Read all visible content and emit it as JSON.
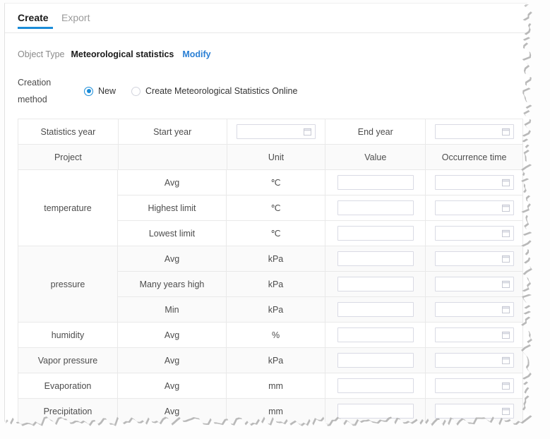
{
  "tabs": [
    {
      "label": "Create",
      "active": true
    },
    {
      "label": "Export",
      "active": false
    }
  ],
  "object_type": {
    "label": "Object Type",
    "value": "Meteorological statistics",
    "modify_link": "Modify"
  },
  "creation_method": {
    "label_line1": "Creation",
    "label_line2": "method",
    "options": [
      {
        "label": "New",
        "selected": true
      },
      {
        "label": "Create Meteorological Statistics Online",
        "selected": false
      }
    ]
  },
  "year_row": {
    "statistics_year_label": "Statistics year",
    "start_year_label": "Start year",
    "start_year_value": "",
    "end_year_label": "End year",
    "end_year_value": ""
  },
  "table": {
    "headers": [
      "Project",
      "",
      "Unit",
      "Value",
      "Occurrence time"
    ],
    "rows": [
      {
        "project": "temperature",
        "rowspan": 3,
        "metric": "Avg",
        "unit": "℃",
        "value": "",
        "time": ""
      },
      {
        "project": "",
        "metric": "Highest limit",
        "unit": "℃",
        "value": "",
        "time": ""
      },
      {
        "project": "",
        "metric": "Lowest limit",
        "unit": "℃",
        "value": "",
        "time": ""
      },
      {
        "project": "pressure",
        "rowspan": 3,
        "metric": "Avg",
        "unit": "kPa",
        "value": "",
        "time": ""
      },
      {
        "project": "",
        "metric": "Many years high",
        "unit": "kPa",
        "value": "",
        "time": ""
      },
      {
        "project": "",
        "metric": "Min",
        "unit": "kPa",
        "value": "",
        "time": ""
      },
      {
        "project": "humidity",
        "rowspan": 1,
        "metric": "Avg",
        "unit": "%",
        "value": "",
        "time": ""
      },
      {
        "project": "Vapor pressure",
        "rowspan": 1,
        "metric": "Avg",
        "unit": "kPa",
        "value": "",
        "time": ""
      },
      {
        "project": "Evaporation",
        "rowspan": 1,
        "metric": "Avg",
        "unit": "mm",
        "value": "",
        "time": ""
      },
      {
        "project": "Precipitation",
        "rowspan": 1,
        "metric": "Avg",
        "unit": "mm",
        "value": "",
        "time": ""
      }
    ]
  },
  "icons": {
    "calendar": "calendar-icon"
  },
  "colors": {
    "accent": "#1a8cd8",
    "link": "#2a7fd4",
    "border": "#e9e9e9",
    "input_border": "#d9dae4",
    "row_shade": "#fafafa",
    "text": "#4d4d4d",
    "muted": "#8a8a8a"
  }
}
